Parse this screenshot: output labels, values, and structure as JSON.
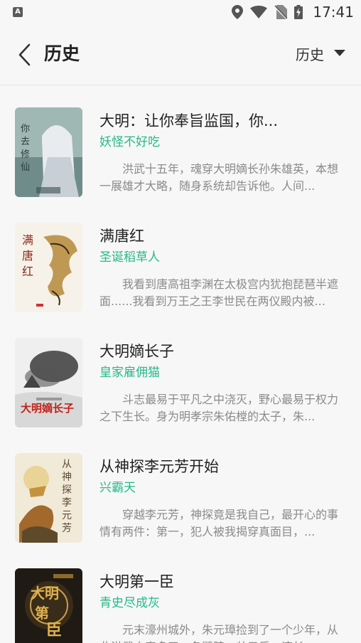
{
  "statusbar": {
    "time": "17:41",
    "icons": [
      "app-notification-icon",
      "location-icon",
      "wifi-icon",
      "no-sim-icon",
      "battery-charging-icon"
    ]
  },
  "header": {
    "title": "历史",
    "filter_label": "历史"
  },
  "books": [
    {
      "title": "大明：让你奉旨监国，你...",
      "author": "妖怪不好吃",
      "description": "洪武十五年，魂穿大明嫡长孙朱雄英，本想一展雄才大略，随身系统却告诉他。人间...",
      "cover_text": "你去修仙"
    },
    {
      "title": "满唐红",
      "author": "圣诞稻草人",
      "description": "我看到唐高祖李渊在太极宫内犹抱琵琶半遮面......我看到万王之王李世民在两仪殿内被...",
      "cover_text": "满唐红"
    },
    {
      "title": "大明嫡长子",
      "author": "皇家雇佣猫",
      "description": "斗志最易于平凡之中浇灭，野心最易于权力之下生长。身为明孝宗朱佑樘的太子，朱...",
      "cover_text": "大明嫡长子"
    },
    {
      "title": "从神探李元芳开始",
      "author": "兴霸天",
      "description": "穿越李元芳，神探竟是我自己，最开心的事情有两件：第一，犯人被我揭穿真面目，...",
      "cover_text": "从神探李元芳"
    },
    {
      "title": "大明第一臣",
      "author": "青史尽成灰",
      "description": "元末濠州城外，朱元璋捡到了一个少年，从此洪武大帝多了一条臂膀，帅元乐，滚长...",
      "cover_text": "大明第一臣"
    }
  ],
  "colors": {
    "author": "#25b88a",
    "background": "#f7f7f7"
  }
}
